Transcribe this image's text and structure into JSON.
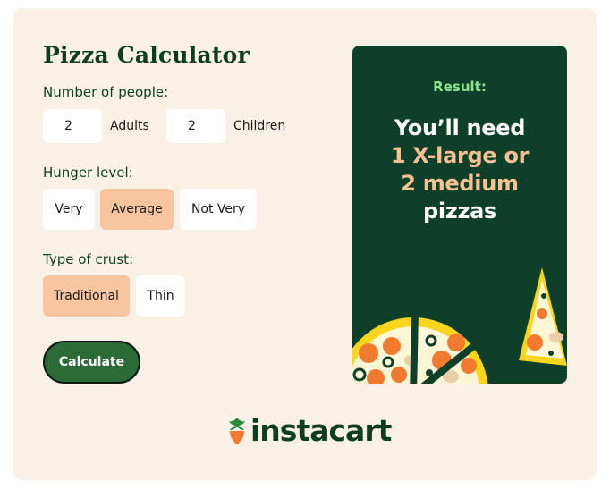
{
  "title": "Pizza Calculator",
  "people": {
    "label": "Number of people:",
    "adults_value": "2",
    "adults_label": "Adults",
    "children_value": "2",
    "children_label": "Children"
  },
  "hunger": {
    "label": "Hunger level:",
    "options": [
      "Very",
      "Average",
      "Not Very"
    ],
    "selected": "Average"
  },
  "crust": {
    "label": "Type of crust:",
    "options": [
      "Traditional",
      "Thin"
    ],
    "selected": "Traditional"
  },
  "calculate_label": "Calculate",
  "result": {
    "label": "Result:",
    "line1": "You’ll need",
    "line2": "1 X-large or",
    "line3": "2 medium",
    "line4": "pizzas"
  },
  "brand": {
    "name": "instacart",
    "logo_icon": "carrot-icon"
  },
  "colors": {
    "background": "#f9f0e6",
    "dark_green": "#0f3d22",
    "accent_orange": "#f8c5a0",
    "button_green": "#2c6a37",
    "result_label_green": "#8fe38f"
  }
}
